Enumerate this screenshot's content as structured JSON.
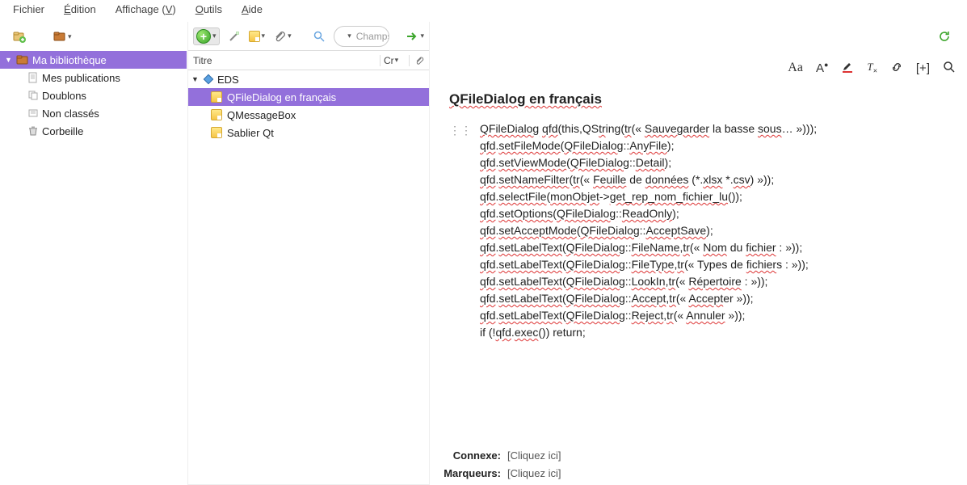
{
  "menu": {
    "file": "Fichier",
    "edit": "Édition",
    "view_pre": "Affichage (",
    "view_key": "V",
    "view_post": ")",
    "tools": "Outils",
    "help": "Aide"
  },
  "left_toolbar": {
    "new_collection": "new-collection",
    "new_library": "new-library"
  },
  "library": {
    "root": "Ma bibliothèque",
    "items": [
      {
        "label": "Mes publications",
        "icon": "page"
      },
      {
        "label": "Doublons",
        "icon": "dup"
      },
      {
        "label": "Non classés",
        "icon": "unfiled"
      },
      {
        "label": "Corbeille",
        "icon": "trash"
      }
    ]
  },
  "mid": {
    "header": {
      "title": "Titre",
      "creator": "Cr",
      "attach_icon": "attachment"
    },
    "group": "EDS",
    "items": [
      {
        "label": "QFileDialog en français",
        "selected": true
      },
      {
        "label": "QMessageBox",
        "selected": false
      },
      {
        "label": "Sablier Qt",
        "selected": false
      }
    ],
    "search_placeholder": "Champs & Marqueurs"
  },
  "note": {
    "title": "QFileDialog en français",
    "lines": [
      "QFileDialog qfd(this,QString(tr(« Sauvegarder la basse sous… »)));",
      "qfd.setFileMode(QFileDialog::AnyFile);",
      "qfd.setViewMode(QFileDialog::Detail);",
      "qfd.setNameFilter(tr(« Feuille de données (*.xlsx *.csv) »));",
      "qfd.selectFile(monObjet->get_rep_nom_fichier_lu());",
      "qfd.setOptions(QFileDialog::ReadOnly);",
      "qfd.setAcceptMode(QFileDialog::AcceptSave);",
      "qfd.setLabelText(QFileDialog::FileName,tr(« Nom du fichier : »));",
      "qfd.setLabelText(QFileDialog::FileType,tr(« Types de fichiers : »));",
      "qfd.setLabelText(QFileDialog::LookIn,tr(« Répertoire : »));",
      "qfd.setLabelText(QFileDialog::Accept,tr(« Accepter »));",
      "qfd.setLabelText(QFileDialog::Reject,tr(« Annuler »));",
      "if (!qfd.exec()) return;"
    ]
  },
  "related": {
    "connexe_label": "Connexe:",
    "connexe_link": "[Cliquez ici]",
    "tags_label": "Marqueurs:",
    "tags_link": "[Cliquez ici]"
  },
  "editor_icons": {
    "aa": "Aa",
    "asup": "A"
  }
}
